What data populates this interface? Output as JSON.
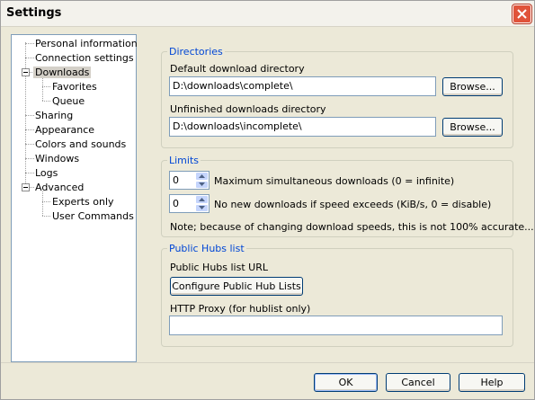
{
  "window": {
    "title": "Settings",
    "close_icon": "close-icon"
  },
  "tree": {
    "items": [
      {
        "label": "Personal information"
      },
      {
        "label": "Connection settings"
      },
      {
        "label": "Downloads",
        "expanded": true,
        "selected": true
      },
      {
        "label": "Favorites"
      },
      {
        "label": "Queue"
      },
      {
        "label": "Sharing"
      },
      {
        "label": "Appearance"
      },
      {
        "label": "Colors and sounds"
      },
      {
        "label": "Windows"
      },
      {
        "label": "Logs"
      },
      {
        "label": "Advanced",
        "expanded": true
      },
      {
        "label": "Experts only"
      },
      {
        "label": "User Commands"
      }
    ]
  },
  "directories": {
    "title": "Directories",
    "default_label": "Default download directory",
    "default_value": "D:\\downloads\\complete\\",
    "browse_label": "Browse...",
    "unfinished_label": "Unfinished downloads directory",
    "unfinished_value": "D:\\downloads\\incomplete\\"
  },
  "limits": {
    "title": "Limits",
    "max_downloads_value": "0",
    "max_downloads_label": "Maximum simultaneous downloads (0 = infinite)",
    "speed_value": "0",
    "speed_label": "No new downloads if speed exceeds (KiB/s, 0 = disable)",
    "note": "Note; because of changing download speeds, this is not 100% accurate..."
  },
  "hubs": {
    "title": "Public Hubs list",
    "url_label": "Public Hubs list URL",
    "configure_label": "Configure Public Hub Lists",
    "proxy_label": "HTTP Proxy (for hublist only)",
    "proxy_value": ""
  },
  "footer": {
    "ok_label": "OK",
    "cancel_label": "Cancel",
    "help_label": "Help"
  },
  "colors": {
    "accent_title": "#0046d5",
    "close_button": "#e0533a"
  }
}
